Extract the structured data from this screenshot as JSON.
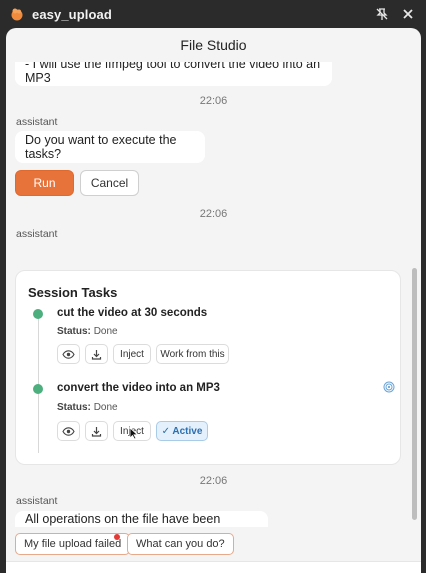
{
  "window": {
    "app_title": "easy_upload",
    "pin_icon": "pin-off-icon",
    "close_icon": "close-icon"
  },
  "header": {
    "title": "File Studio"
  },
  "messages": {
    "first_bubble": "- I will use the ffmpeg tool to convert the video into an MP3",
    "time1": "22:06",
    "role1": "assistant",
    "question": "Do you want to execute the tasks?",
    "run_label": "Run",
    "cancel_label": "Cancel",
    "time2": "22:06",
    "role2": "assistant",
    "time3": "22:06",
    "role3": "assistant",
    "final": "All operations on the file have been performed."
  },
  "session": {
    "title": "Session Tasks",
    "tasks": [
      {
        "title": "cut the video at 30 seconds",
        "status_label": "Status:",
        "status": "Done",
        "inject_label": "Inject",
        "work_label": "Work from this"
      },
      {
        "title": "convert the video into an MP3",
        "status_label": "Status:",
        "status": "Done",
        "inject_label": "Inject",
        "active_label": "✓ Active"
      }
    ]
  },
  "suggestions": [
    {
      "label": "My file upload failed"
    },
    {
      "label": "What can you do?"
    }
  ],
  "colors": {
    "accent": "#e8733a",
    "done_dot": "#4caf7d",
    "active_blue": "#2a6fb0",
    "notify": "#e53935"
  }
}
